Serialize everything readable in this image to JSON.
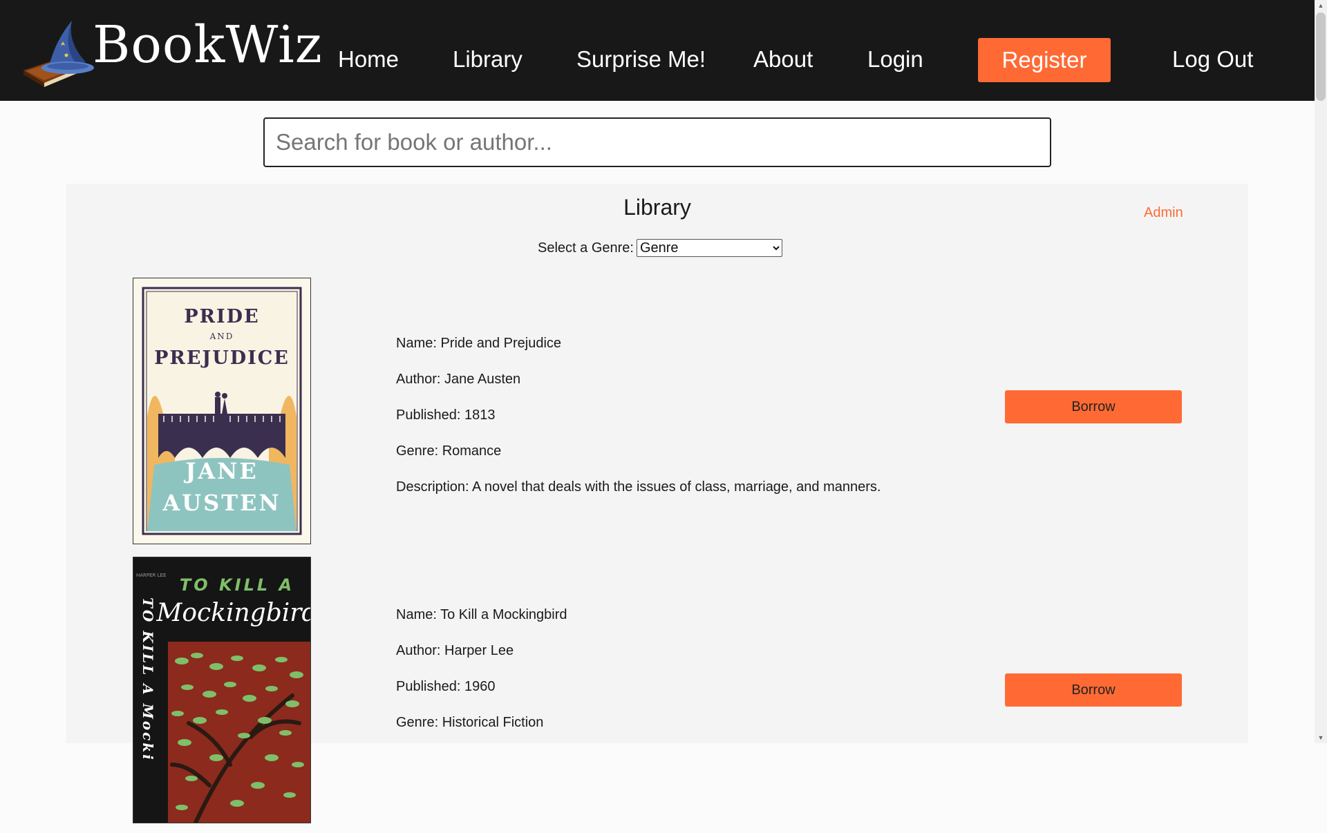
{
  "header": {
    "brand": "BookWiz",
    "nav": {
      "home": "Home",
      "library": "Library",
      "surprise": "Surprise Me!",
      "about": "About",
      "login": "Login",
      "register": "Register",
      "logout": "Log Out"
    },
    "accent_color": "#ff6a34",
    "background_color": "#181818"
  },
  "search": {
    "placeholder": "Search for book or author..."
  },
  "library": {
    "title": "Library",
    "admin_link": "Admin",
    "genre_label": "Select a Genre:",
    "genre_selected": "Genre"
  },
  "books": [
    {
      "name": "Name: Pride and Prejudice",
      "author": "Author: Jane Austen",
      "published": "Published: 1813",
      "genre": "Genre: Romance",
      "description": "Description: A novel that deals with the issues of class, marriage, and manners.",
      "borrow_label": "Borrow",
      "cover_text": {
        "line1": "PRIDE",
        "line2": "AND",
        "line3": "PREJUDICE",
        "line4": "JANE",
        "line5": "AUSTEN"
      }
    },
    {
      "name": "Name: To Kill a Mockingbird",
      "author": "Author: Harper Lee",
      "published": "Published: 1960",
      "genre": "Genre: Historical Fiction",
      "borrow_label": "Borrow",
      "cover_text": {
        "line1": "TO KILL A",
        "line2": "Mockingbird",
        "spine": "TO KILL A Mocki",
        "publisher": "HARPER LEE"
      }
    }
  ]
}
